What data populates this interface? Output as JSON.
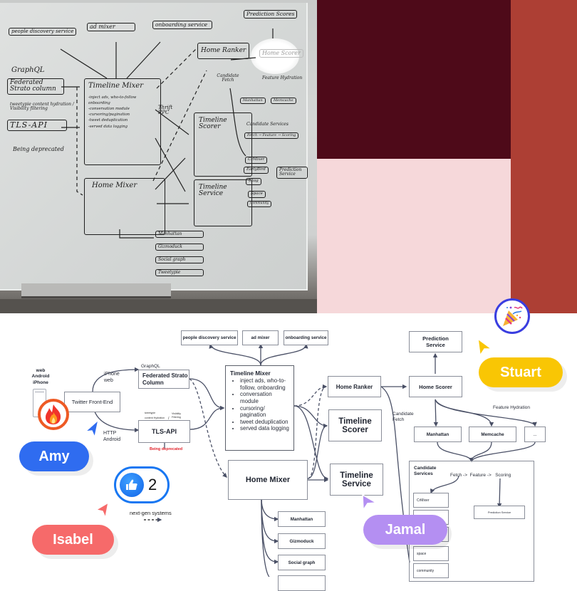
{
  "whiteboard": {
    "boxes": {
      "people_discovery": "people discovery service",
      "ad_mixer": "ad mixer",
      "onboarding": "onboarding service",
      "prediction_scores": "Prediction Scores",
      "home_ranker": "Home Ranker",
      "home_scorer": "Home Scorer",
      "federated": "Federated Strato column",
      "tls_api": "TLS-API",
      "timeline_mixer": "Timeline Mixer",
      "timeline_scorer": "Timeline Scorer",
      "home_mixer": "Home Mixer",
      "timeline_service": "Timeline Service",
      "manhattan": "Manhattan",
      "memcache": "Memcache",
      "crmixer": "CrMixer",
      "earlybird": "EarlyBird",
      "utag": "Utag",
      "space": "Space",
      "community": "Community",
      "prediction_service": "Prediction Service",
      "bottom_manhattan": "Manhattan",
      "bottom_gizmoduck": "Gizmoduck",
      "bottom_social": "Social graph",
      "bottom_tweetypie": "Tweetypie"
    },
    "notes": {
      "graphql": "GraphQL",
      "tweetypie_hydration": "tweetypie content hydration / Visibility filtering",
      "deprecated": "Being deprecated",
      "thrift": "Thrift RPC",
      "candidate_fetch": "Candidate Fetch",
      "feature_hydration": "Feature Hydration",
      "candidate_services": "Candidate Services",
      "fetch_feature_scoring": "Fetch → Feature → Scoring",
      "timeline_mixer_items": [
        "-inject ads, who-to-follow onboarding",
        "-conversation module",
        "-cursoring/pagination",
        "-tweet deduplication",
        "-served data logging"
      ]
    }
  },
  "swatches": {
    "dark": "#4e0a19",
    "pink": "#f6d8da",
    "red": "#ad3f34"
  },
  "diagram": {
    "clients": {
      "web": "web",
      "android": "Android",
      "iphone": "iPhone"
    },
    "front_end": "Twitter Front-End",
    "edge_labels": {
      "iphone_web": [
        "iPhone",
        "web"
      ],
      "http_android": [
        "HTTP",
        "Android"
      ],
      "graphql": "GraphQL",
      "tweetypie": "tweetypie",
      "content_hydration": "content Hydration",
      "visibility": "Visibility",
      "filtering": "Filtering",
      "candidate_fetch": [
        "Candidate",
        "Fetch"
      ],
      "feature_hydration": "Feature Hydration"
    },
    "federated": "Federated Strato Column",
    "tls_api": "TLS-API",
    "deprecated": "Being deprecated",
    "top_services": [
      "people discovery service",
      "ad mixer",
      "onboarding service"
    ],
    "timeline_mixer": {
      "title": "Timeline Mixer",
      "items": [
        "inject ads, who-to-follow, onboarding",
        "conversation module",
        "cursoring/ pagination",
        "tweet deduplication",
        "served data logging"
      ]
    },
    "home_ranker": "Home Ranker",
    "timeline_scorer": "Timeline Scorer",
    "timeline_service": "Timeline Service",
    "home_mixer": "Home Mixer",
    "home_mixer_deps": [
      "Manhattan",
      "Gizmoduck",
      "Social graph",
      ""
    ],
    "prediction_service_top": "Prediction Service",
    "home_scorer": "Home Scorer",
    "hydration_stores": [
      "Manhattan",
      "Memcache",
      "..."
    ],
    "candidate_services": {
      "title": "Candidate Services",
      "flow": "Fetch ->  Feature ->   Scoring",
      "list": [
        "CrMixer",
        "",
        "",
        "space",
        "community"
      ],
      "prediction_service": "Prediction Service"
    },
    "legend": {
      "label": "next-gen systems"
    }
  },
  "reactions": {
    "like_count": "2"
  },
  "collaborators": [
    {
      "name": "Amy",
      "color": "#2f6cf0"
    },
    {
      "name": "Isabel",
      "color": "#f66a6a"
    },
    {
      "name": "Stuart",
      "color": "#f9c604"
    },
    {
      "name": "Jamal",
      "color": "#b48ff2"
    }
  ]
}
